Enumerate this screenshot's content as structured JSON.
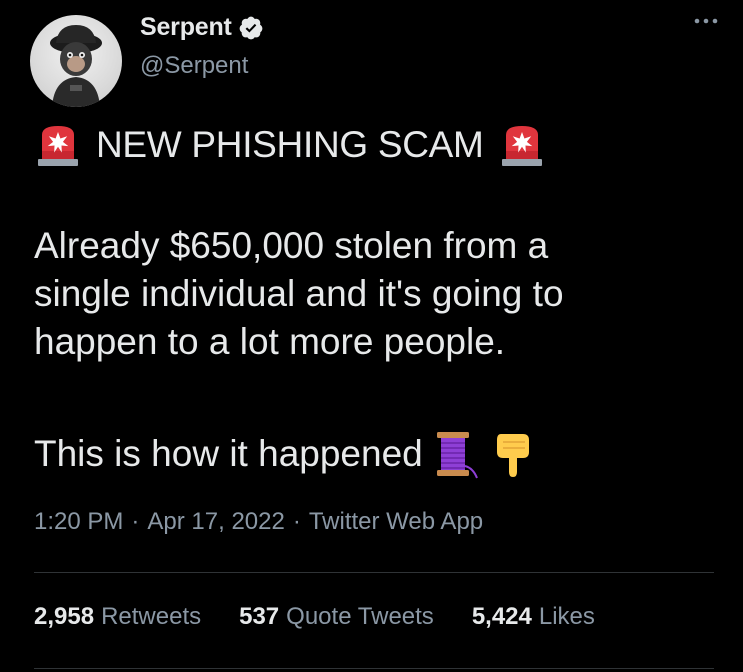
{
  "author": {
    "display_name": "Serpent",
    "handle": "@Serpent",
    "verified": true
  },
  "tweet": {
    "headline": "NEW PHISHING SCAM",
    "body": "Already $650,000 stolen from a\nsingle individual and it's going to\nhappen to a lot more people.",
    "thread_line": "This is how it happened",
    "time": "1:20 PM",
    "date": "Apr 17, 2022",
    "source": "Twitter Web App",
    "separator": "·"
  },
  "stats": {
    "retweets_count": "2,958",
    "retweets_label": "Retweets",
    "quotes_count": "537",
    "quotes_label": "Quote Tweets",
    "likes_count": "5,424",
    "likes_label": "Likes"
  },
  "icons": {
    "avatar": "avatar-image",
    "verified": "verified-badge-icon",
    "more": "more-options-icon",
    "siren": "police-siren-icon",
    "thread": "thread-spool-icon",
    "point_down": "point-down-icon"
  },
  "colors": {
    "background": "#000000",
    "text": "#e7e9ea",
    "secondary_text": "#8b98a5",
    "divider": "#2f3336"
  }
}
